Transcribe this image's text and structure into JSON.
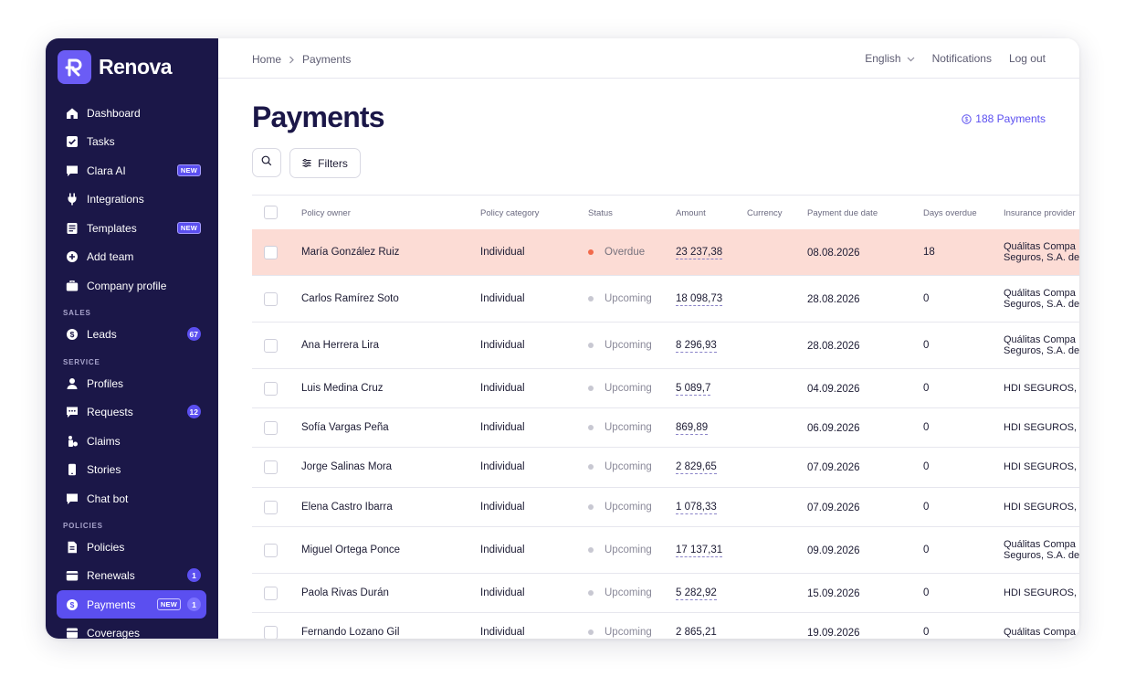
{
  "app": {
    "brand": "Renova"
  },
  "sidebar": {
    "items": [
      {
        "label": "Dashboard",
        "icon": "home-icon"
      },
      {
        "label": "Tasks",
        "icon": "checkbox-icon"
      },
      {
        "label": "Clara AI",
        "icon": "chat-icon",
        "badge": "NEW"
      },
      {
        "label": "Integrations",
        "icon": "plug-icon"
      },
      {
        "label": "Templates",
        "icon": "template-icon",
        "badge": "NEW"
      },
      {
        "label": "Add team",
        "icon": "plus-circle-icon"
      },
      {
        "label": "Company profile",
        "icon": "briefcase-icon"
      },
      {
        "label": "Leads",
        "icon": "dollar-icon",
        "count": "67"
      },
      {
        "label": "Profiles",
        "icon": "person-icon"
      },
      {
        "label": "Requests",
        "icon": "message-icon",
        "count": "12"
      },
      {
        "label": "Claims",
        "icon": "claims-icon"
      },
      {
        "label": "Stories",
        "icon": "phone-icon"
      },
      {
        "label": "Chat bot",
        "icon": "chat-bubble-icon"
      },
      {
        "label": "Policies",
        "icon": "document-icon"
      },
      {
        "label": "Renewals",
        "icon": "wallet-icon",
        "count": "1"
      },
      {
        "label": "Payments",
        "icon": "dollar-icon",
        "badge": "NEW",
        "count": "1",
        "active": true
      },
      {
        "label": "Coverages",
        "icon": "coverage-icon"
      }
    ],
    "sections": {
      "sales": "SALES",
      "service": "SERVICE",
      "policies": "POLICIES"
    }
  },
  "topbar": {
    "breadcrumb": [
      "Home",
      "Payments"
    ],
    "language": "English",
    "notifications": "Notifications",
    "logout": "Log out"
  },
  "page": {
    "title": "Payments",
    "count_label": "188 Payments",
    "filters_label": "Filters"
  },
  "table": {
    "columns": [
      "Policy owner",
      "Policy category",
      "Status",
      "Amount",
      "Currency",
      "Payment due date",
      "Days overdue",
      "Insurance provider"
    ],
    "rows": [
      {
        "owner": "María González Ruiz",
        "category": "Individual",
        "status": "Overdue",
        "amount": "23 237,38",
        "currency": "",
        "due": "08.08.2026",
        "days": "18",
        "provider": [
          "Quálitas Compa",
          "Seguros, S.A. de"
        ],
        "overdue": true
      },
      {
        "owner": "Carlos Ramírez Soto",
        "category": "Individual",
        "status": "Upcoming",
        "amount": "18 098,73",
        "currency": "",
        "due": "28.08.2026",
        "days": "0",
        "provider": [
          "Quálitas Compa",
          "Seguros, S.A. de"
        ]
      },
      {
        "owner": "Ana Herrera Lira",
        "category": "Individual",
        "status": "Upcoming",
        "amount": "8 296,93",
        "currency": "",
        "due": "28.08.2026",
        "days": "0",
        "provider": [
          "Quálitas Compa",
          "Seguros, S.A. de"
        ]
      },
      {
        "owner": "Luis Medina Cruz",
        "category": "Individual",
        "status": "Upcoming",
        "amount": "5 089,7",
        "currency": "",
        "due": "04.09.2026",
        "days": "0",
        "provider": [
          "HDI SEGUROS, S"
        ]
      },
      {
        "owner": "Sofía Vargas Peña",
        "category": "Individual",
        "status": "Upcoming",
        "amount": "869,89",
        "currency": "",
        "due": "06.09.2026",
        "days": "0",
        "provider": [
          "HDI SEGUROS, S"
        ]
      },
      {
        "owner": "Jorge Salinas Mora",
        "category": "Individual",
        "status": "Upcoming",
        "amount": "2 829,65",
        "currency": "",
        "due": "07.09.2026",
        "days": "0",
        "provider": [
          "HDI SEGUROS, S"
        ]
      },
      {
        "owner": "Elena Castro Ibarra",
        "category": "Individual",
        "status": "Upcoming",
        "amount": "1 078,33",
        "currency": "",
        "due": "07.09.2026",
        "days": "0",
        "provider": [
          "HDI SEGUROS, S"
        ]
      },
      {
        "owner": "Miguel Ortega Ponce",
        "category": "Individual",
        "status": "Upcoming",
        "amount": "17 137,31",
        "currency": "",
        "due": "09.09.2026",
        "days": "0",
        "provider": [
          "Quálitas Compa",
          "Seguros, S.A. de"
        ]
      },
      {
        "owner": "Paola Rivas Durán",
        "category": "Individual",
        "status": "Upcoming",
        "amount": "5 282,92",
        "currency": "",
        "due": "15.09.2026",
        "days": "0",
        "provider": [
          "HDI SEGUROS, S"
        ]
      },
      {
        "owner": "Fernando Lozano Gil",
        "category": "Individual",
        "status": "Upcoming",
        "amount": "2 865,21",
        "currency": "",
        "due": "19.09.2026",
        "days": "0",
        "provider": [
          "Quálitas Compa"
        ]
      }
    ]
  },
  "colors": {
    "sidebar_bg": "#1b1748",
    "accent": "#5b4ff0",
    "overdue_row": "#fcdcd5",
    "overdue_dot": "#f26a4b"
  }
}
